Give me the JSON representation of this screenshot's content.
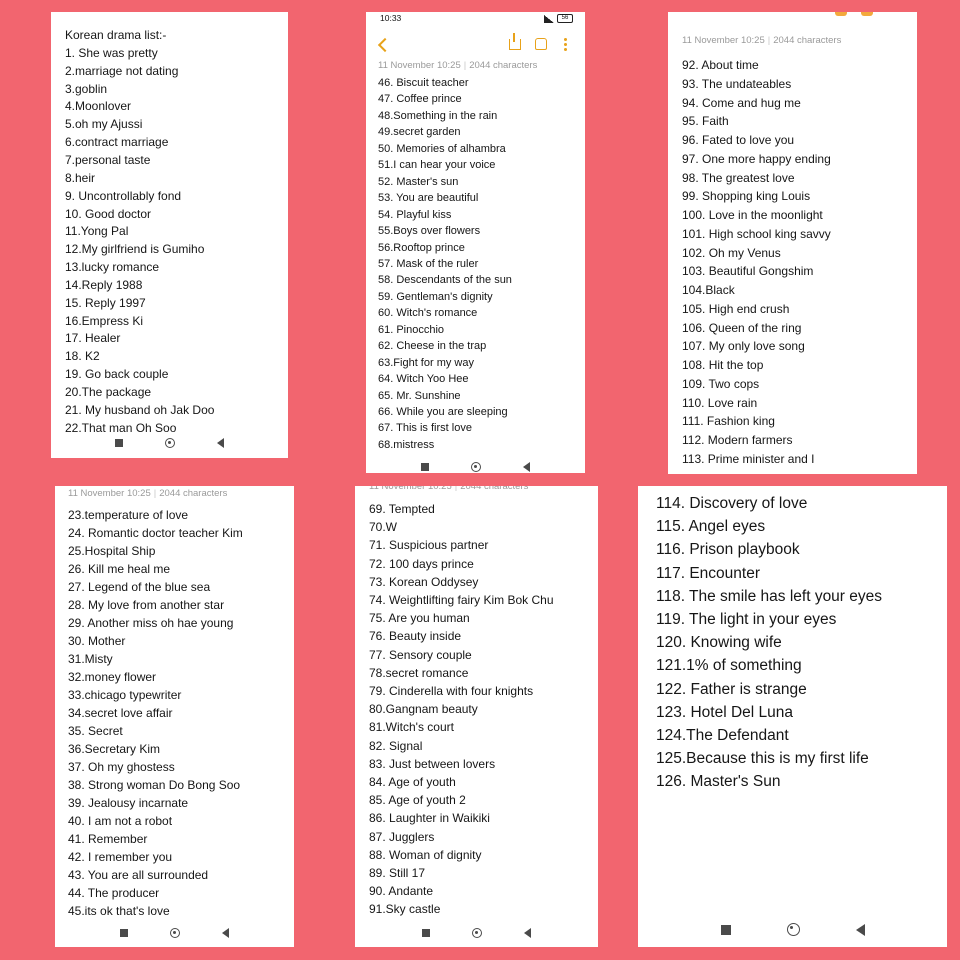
{
  "meta": {
    "date": "11 November",
    "time": "10:25",
    "chars": "2044 characters"
  },
  "panel2_status": {
    "time": "10:33",
    "battery": "56"
  },
  "panel1": {
    "items": [
      "Korean drama list:-",
      "1. She was pretty",
      "2.marriage not dating",
      "3.goblin",
      "4.Moonlover",
      "5.oh my Ajussi",
      "6.contract marriage",
      "7.personal taste",
      "8.heir",
      "9. Uncontrollably fond",
      "10. Good doctor",
      "11.Yong Pal",
      "12.My girlfriend is Gumiho",
      "13.lucky romance",
      "14.Reply 1988",
      "15. Reply 1997",
      "16.Empress Ki",
      "17. Healer",
      "18. K2",
      "19. Go back couple",
      "20.The package",
      "21. My husband oh Jak Doo",
      "22.That man Oh Soo"
    ]
  },
  "panel2": {
    "items": [
      "46. Biscuit teacher",
      "47. Coffee prince",
      "48.Something in the rain",
      "49.secret garden",
      "50. Memories of alhambra",
      "51.I can hear your voice",
      "52. Master's sun",
      "53. You are beautiful",
      "54. Playful kiss",
      "55.Boys over flowers",
      "56.Rooftop prince",
      "57. Mask of the ruler",
      "58. Descendants of the sun",
      "59. Gentleman's dignity",
      "60. Witch's romance",
      "61. Pinocchio",
      "62. Cheese in the trap",
      "63.Fight for my way",
      "64. Witch Yoo Hee",
      "65. Mr. Sunshine",
      "66. While you are sleeping",
      "67. This is first love",
      "68.mistress"
    ]
  },
  "panel3": {
    "items": [
      "92. About time",
      "93. The undateables",
      "94. Come and hug me",
      "95. Faith",
      "96. Fated to love you",
      "97. One more happy ending",
      "98. The greatest love",
      "99. Shopping king Louis",
      "100. Love in the moonlight",
      "101. High school king savvy",
      "102. Oh my Venus",
      "103. Beautiful Gongshim",
      "104.Black",
      "105. High end crush",
      "106. Queen of the ring",
      "107. My only love song",
      "108. Hit the top",
      "109. Two cops",
      "110. Love rain",
      "111. Fashion king",
      "112. Modern farmers",
      "113. Prime minister and I"
    ]
  },
  "panel4": {
    "items": [
      "23.temperature of love",
      "24. Romantic doctor teacher Kim",
      "25.Hospital Ship",
      "26. Kill me heal me",
      "27. Legend of the blue sea",
      "28. My love from another star",
      "29. Another miss oh hae young",
      "30. Mother",
      "31.Misty",
      "32.money flower",
      "33.chicago typewriter",
      "34.secret love affair",
      "35. Secret",
      "36.Secretary Kim",
      "37. Oh my ghostess",
      "38. Strong woman Do Bong Soo",
      "39. Jealousy incarnate",
      "40. I am not a robot",
      "41. Remember",
      "42. I remember you",
      "43. You are all surrounded",
      "44. The producer",
      "45.its ok that's love"
    ]
  },
  "panel5": {
    "items": [
      "69. Tempted",
      "70.W",
      "71. Suspicious partner",
      "72. 100 days prince",
      "73. Korean Oddysey",
      "74. Weightlifting fairy Kim Bok Chu",
      "75. Are you human",
      "76. Beauty inside",
      "77. Sensory couple",
      "78.secret romance",
      "79. Cinderella with four knights",
      "80.Gangnam beauty",
      "81.Witch's court",
      "82. Signal",
      "83. Just between lovers",
      "84. Age of youth",
      "85. Age of youth 2",
      "86. Laughter in Waikiki",
      "87. Jugglers",
      "88. Woman of dignity",
      "89. Still 17",
      "90. Andante",
      "91.Sky castle"
    ]
  },
  "panel6": {
    "items": [
      "114. Discovery of love",
      "115. Angel eyes",
      "116. Prison playbook",
      "117. Encounter",
      "118. The smile has left your eyes",
      "119. The light in your eyes",
      "120. Knowing wife",
      "121.1% of something",
      "122. Father is strange",
      "123. Hotel Del Luna",
      "124.The Defendant",
      "125.Because this is my first life",
      "126. Master's Sun"
    ]
  }
}
